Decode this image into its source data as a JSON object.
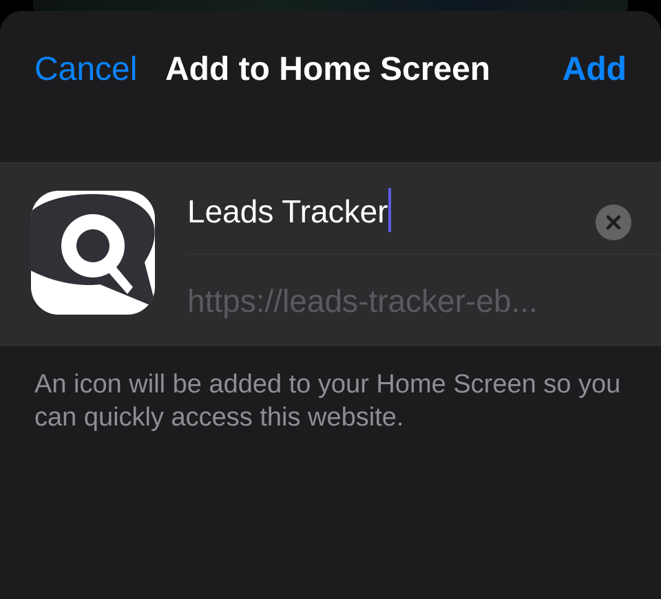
{
  "header": {
    "cancel_label": "Cancel",
    "title": "Add to Home Screen",
    "add_label": "Add"
  },
  "form": {
    "app_icon": "speech-bubble-q-icon",
    "name_value": "Leads Tracker",
    "clear_icon": "clear-x-icon",
    "url_text": "https://leads-tracker-eb..."
  },
  "footer": {
    "description": "An icon will be added to your Home Screen so you can quickly access this website."
  },
  "colors": {
    "accent": "#0a84ff",
    "sheet_background": "#1c1c1e",
    "group_background": "#2c2c2e",
    "caret": "#5e5ce6"
  }
}
